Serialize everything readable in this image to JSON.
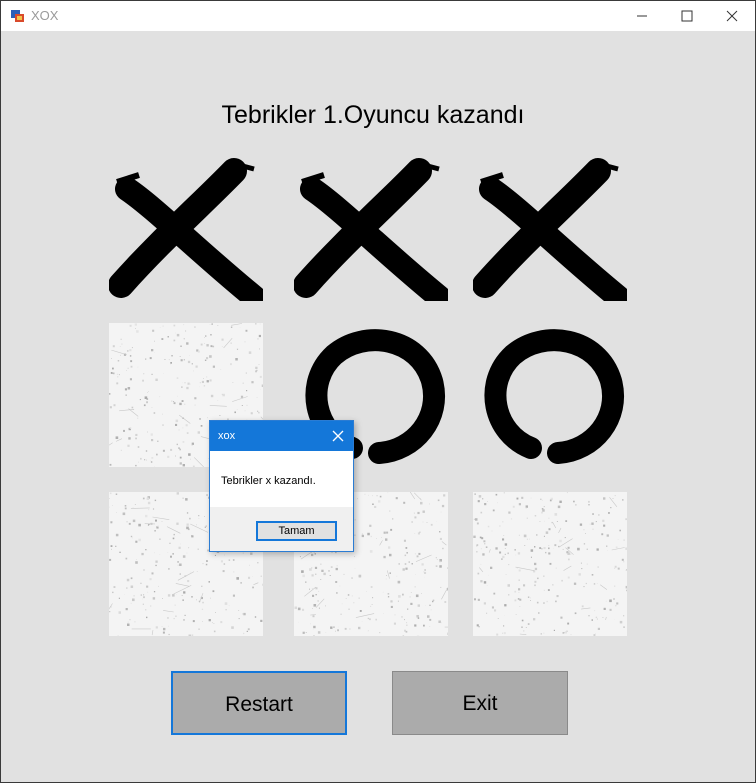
{
  "window": {
    "title": "XOX",
    "icon": "app-icon"
  },
  "title_buttons": [
    "minimize-icon",
    "maximize-icon",
    "close-icon"
  ],
  "heading": "Tebrikler 1.Oyuncu kazandı",
  "board": [
    [
      "X",
      "X",
      "X"
    ],
    [
      "",
      "O",
      "O"
    ],
    [
      "",
      "",
      ""
    ]
  ],
  "buttons": {
    "restart": "Restart",
    "exit": "Exit"
  },
  "dialog": {
    "title": "xox",
    "message": "Tebrikler x kazandı.",
    "ok": "Tamam"
  },
  "colors": {
    "dialog_accent": "#1477d9",
    "button_gray": "#ababab",
    "window_bg": "#e1e1e1"
  }
}
